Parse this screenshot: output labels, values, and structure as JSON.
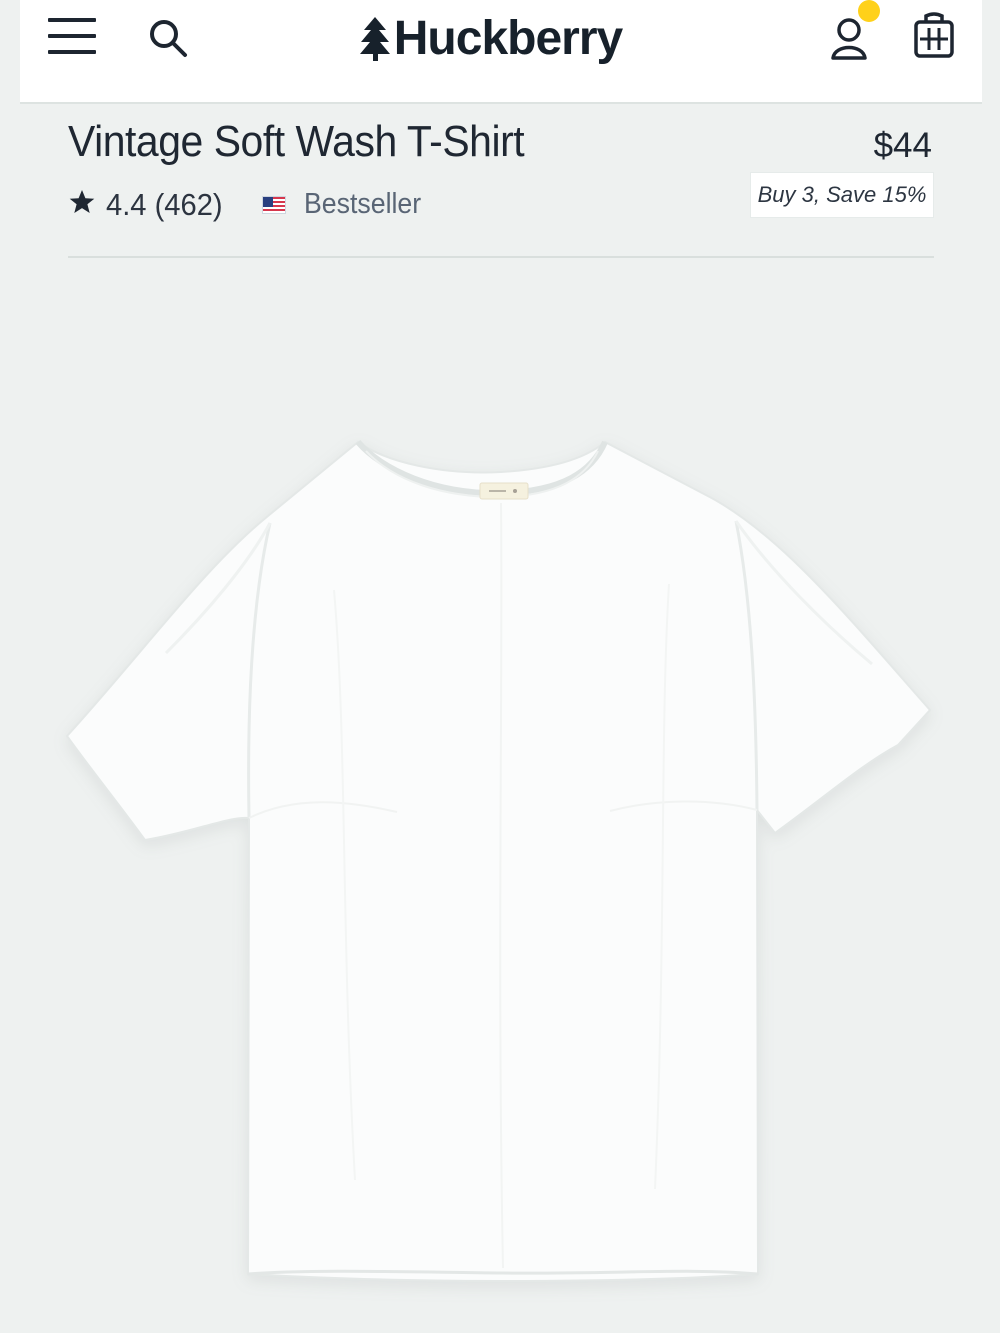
{
  "header": {
    "brand": "Huckberry",
    "icons": {
      "menu": "hamburger-menu-icon",
      "search": "search-icon",
      "account": "account-icon",
      "cart": "cart-icon",
      "tree": "tree-icon"
    },
    "notification_color": "#ffd11a"
  },
  "product": {
    "title": "Vintage Soft Wash T-Shirt",
    "price": "$44",
    "rating_text": "4.4 (462)",
    "origin_icon": "us-flag-icon",
    "badge": "Bestseller",
    "promotion": "Buy 3, Save 15%",
    "image_icon": "white-t-shirt-image"
  },
  "colors": {
    "background": "#eef1f0",
    "header_background": "#ffffff",
    "text": "#1f2732",
    "muted_text": "#596575",
    "accent_yellow": "#ffd11a"
  }
}
